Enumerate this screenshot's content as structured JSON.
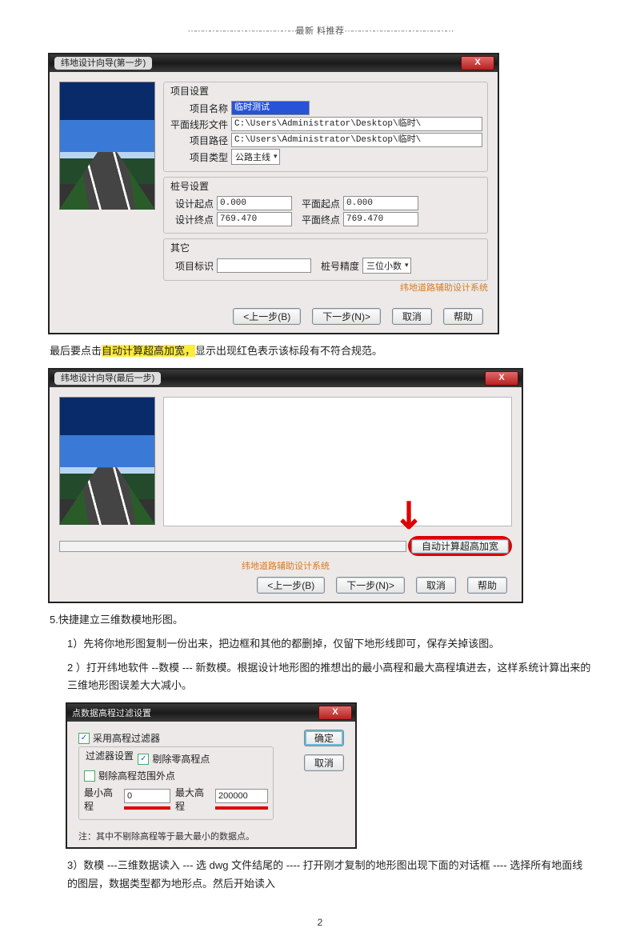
{
  "header_label": "最新 料推荐",
  "dialog1": {
    "title": "纬地设计向导(第一步)",
    "grp1_title": "项目设置",
    "proj_name_label": "项目名称",
    "proj_name_value": "临时测试",
    "plane_file_label": "平面线形文件",
    "plane_file_value": "C:\\Users\\Administrator\\Desktop\\临时\\",
    "proj_path_label": "项目路径",
    "proj_path_value": "C:\\Users\\Administrator\\Desktop\\临时\\",
    "proj_type_label": "项目类型",
    "proj_type_value": "公路主线",
    "grp2_title": "桩号设置",
    "design_start_label": "设计起点",
    "design_start_value": "0.000",
    "plane_start_label": "平面起点",
    "plane_start_value": "0.000",
    "design_end_label": "设计终点",
    "design_end_value": "769.470",
    "plane_end_label": "平面终点",
    "plane_end_value": "769.470",
    "grp3_title": "其它",
    "proj_mark_label": "项目标识",
    "proj_mark_value": "",
    "stake_prec_label": "桩号精度",
    "stake_prec_value": "三位小数",
    "brand": "纬地道路辅助设计系统",
    "prev": "<上一步(B)",
    "next": "下一步(N)>",
    "cancel": "取消",
    "help": "帮助"
  },
  "text1_a": "最后要点击",
  "text1_b": "自动计算超高加宽，",
  "text1_c": "显示出现红色表示该标段有不符合规范。",
  "dialog2": {
    "title": "纬地设计向导(最后一步)",
    "auto_btn": "自动计算超高加宽",
    "brand": "纬地道路辅助设计系统",
    "prev": "<上一步(B)",
    "next": "下一步(N)>",
    "cancel": "取消",
    "help": "帮助"
  },
  "section5_title": "5.快捷建立三维数模地形图。",
  "section5_p1": "1）先将你地形图复制一份出来，把边框和其他的都删掉，仅留下地形线即可，保存关掉该图。",
  "section5_p2": "2 ）打开纬地软件  --数模 --- 新数模。根据设计地形图的推想出的最小高程和最大高程填进去，这样系统计算出来的三维地形图误差大大减小。",
  "dialog3": {
    "title": "点数据高程过滤设置",
    "ok": "确定",
    "cancel": "取消",
    "use_filter": "采用高程过滤器",
    "filter_grp": "过滤器设置",
    "del_zero": "剔除零高程点",
    "del_out": "剔除高程范围外点",
    "min_label": "最小高程",
    "min_value": "0",
    "max_label": "最大高程",
    "max_value": "200000",
    "note": "注：其中不剔除高程等于最大最小的数据点。"
  },
  "section5_p3": "3）数模 ---三维数据读入  --- 选 dwg  文件结尾的 ---- 打开刚才复制的地形图出现下面的对话框 ---- 选择所有地面线的图层，数据类型都为地形点。然后开始读入",
  "page_number": "2"
}
